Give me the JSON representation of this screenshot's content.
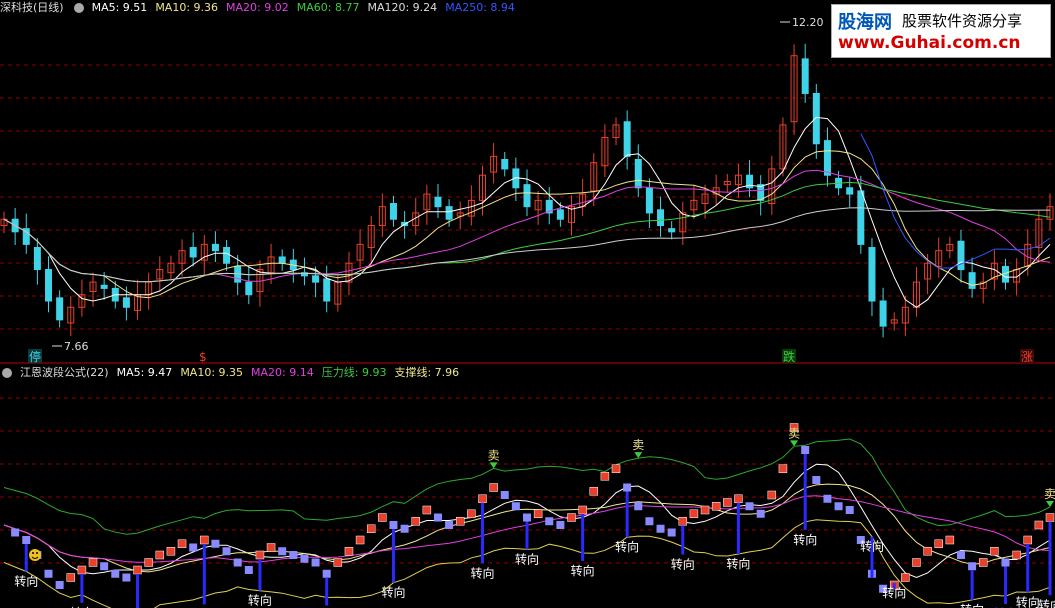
{
  "colors": {
    "up": "#e8402a",
    "down": "#3fd3e8",
    "ma5": "#ffffff",
    "ma10": "#f0e68c",
    "ma20": "#e040e0",
    "ma60": "#3ccc3c",
    "ma120": "#cccccc",
    "ma250": "#3355ff",
    "band_up": "#2ea82e",
    "band_lo": "#e0d050"
  },
  "top_legend": {
    "title": "深科技(日线)",
    "items": [
      {
        "text": "MA5: 9.51",
        "color": "#ffffff"
      },
      {
        "text": "MA10: 9.36",
        "color": "#f0e68c"
      },
      {
        "text": "MA20: 9.02",
        "color": "#e040e0"
      },
      {
        "text": "MA60: 8.77",
        "color": "#3ccc3c"
      },
      {
        "text": "MA120: 9.24",
        "color": "#dddddd"
      },
      {
        "text": "MA250: 8.94",
        "color": "#3355ff"
      }
    ]
  },
  "bottom_legend": {
    "title": "江恩波段公式(22)",
    "items": [
      {
        "text": "MA5: 9.47",
        "color": "#ffffff"
      },
      {
        "text": "MA10: 9.35",
        "color": "#f0e68c"
      },
      {
        "text": "MA20: 9.14",
        "color": "#e040e0"
      },
      {
        "text": "压力线: 9.93",
        "color": "#3ccc3c"
      },
      {
        "text": "支撑线: 7.96",
        "color": "#f0e68c"
      }
    ]
  },
  "watermark": {
    "line1": "股海网",
    "line2": "股票软件资源分享",
    "line3": "www.Guhai.com.cn"
  },
  "chart_data": [
    {
      "type": "candlestick",
      "title": "深科技(日线)",
      "y_range": [
        7.3,
        12.5
      ],
      "annotations": [
        {
          "text": "12.20",
          "y": 12.2
        },
        {
          "text": "7.66",
          "y": 7.66
        }
      ],
      "markers": [
        {
          "text": "停",
          "color": "#3fd3e8"
        },
        {
          "text": "$",
          "color": "#e8402a"
        },
        {
          "text": "跌",
          "color": "#3ccc3c"
        },
        {
          "text": "涨",
          "color": "#e8402a"
        }
      ],
      "close": [
        9.3,
        9.1,
        8.9,
        8.5,
        8.0,
        7.7,
        7.9,
        8.1,
        8.3,
        8.2,
        8.0,
        7.9,
        8.1,
        8.3,
        8.5,
        8.6,
        8.8,
        8.7,
        8.9,
        8.8,
        8.6,
        8.3,
        8.1,
        8.5,
        8.7,
        8.6,
        8.5,
        8.4,
        8.3,
        8.0,
        8.3,
        8.6,
        8.9,
        9.2,
        9.5,
        9.3,
        9.2,
        9.4,
        9.7,
        9.5,
        9.3,
        9.4,
        9.6,
        10.0,
        10.3,
        10.1,
        9.8,
        9.5,
        9.6,
        9.4,
        9.3,
        9.5,
        9.7,
        10.2,
        10.6,
        10.8,
        10.3,
        9.8,
        9.4,
        9.2,
        9.1,
        9.4,
        9.6,
        9.7,
        9.8,
        9.9,
        10.0,
        9.8,
        9.6,
        10.1,
        10.8,
        11.9,
        11.3,
        10.5,
        10.0,
        9.8,
        9.7,
        8.9,
        8.0,
        7.6,
        7.7,
        7.9,
        8.3,
        8.6,
        8.8,
        8.9,
        8.5,
        8.2,
        8.3,
        8.6,
        8.3,
        8.5,
        8.9,
        9.3,
        9.5
      ],
      "ma5_last": 9.51,
      "ma10_last": 9.36,
      "ma20_last": 9.02,
      "ma60_last": 8.77,
      "ma120_last": 9.24,
      "ma250_last": 8.94
    },
    {
      "type": "line",
      "title": "江恩波段公式(22)",
      "signals": {
        "turn_label": "转向",
        "sell_label": "卖",
        "turn_count": 20,
        "sell_count": 4
      },
      "ma5_last": 9.47,
      "ma10_last": 9.35,
      "ma20_last": 9.14,
      "pressure_last": 9.93,
      "support_last": 7.96
    }
  ]
}
